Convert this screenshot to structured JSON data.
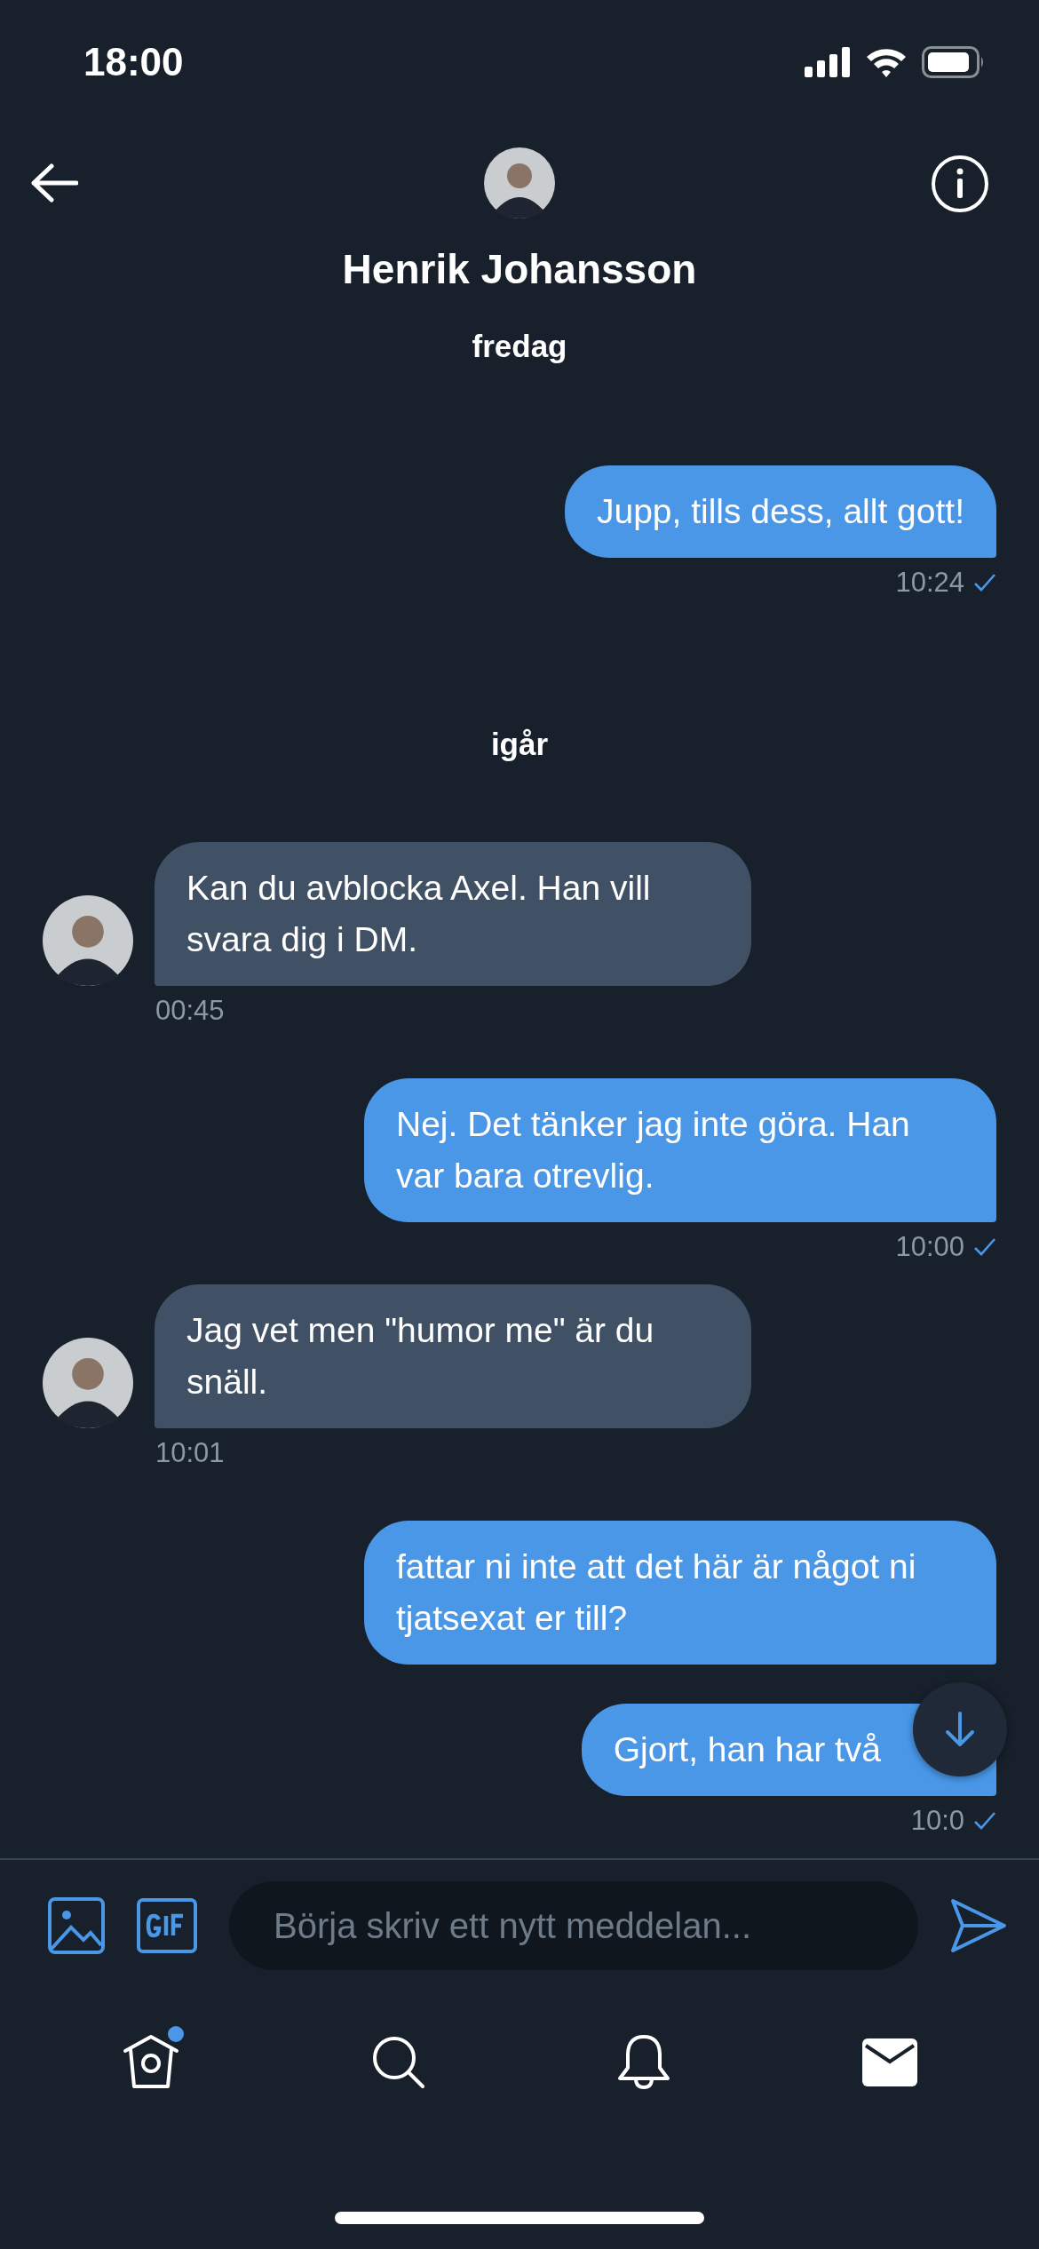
{
  "status_bar": {
    "time": "18:00"
  },
  "header": {
    "name": "Henrik Johansson"
  },
  "messages": [
    {
      "kind": "date",
      "text": "fredag"
    },
    {
      "kind": "outgoing",
      "text": "Jupp, tills dess, allt gott!",
      "time": "10:24",
      "seen": true
    },
    {
      "kind": "date",
      "text": "igår"
    },
    {
      "kind": "incoming",
      "text": "Kan du avblocka Axel. Han vill svara dig i DM.",
      "time": "00:45"
    },
    {
      "kind": "outgoing",
      "text": "Nej. Det tänker jag inte göra. Han var bara otrevlig.",
      "time": "10:00",
      "seen": true
    },
    {
      "kind": "incoming",
      "text": "Jag vet men \"humor me\" är du snäll.",
      "time": "10:01"
    },
    {
      "kind": "outgoing",
      "text": "fattar ni inte att det här är något ni tjatsexat er till?"
    },
    {
      "kind": "outgoing",
      "text": "Gjort, han har två",
      "time": "10:0",
      "seen": true
    }
  ],
  "composer": {
    "placeholder": "Börja skriv ett nytt meddelan..."
  },
  "tab_bar": {
    "home_badge": true
  }
}
